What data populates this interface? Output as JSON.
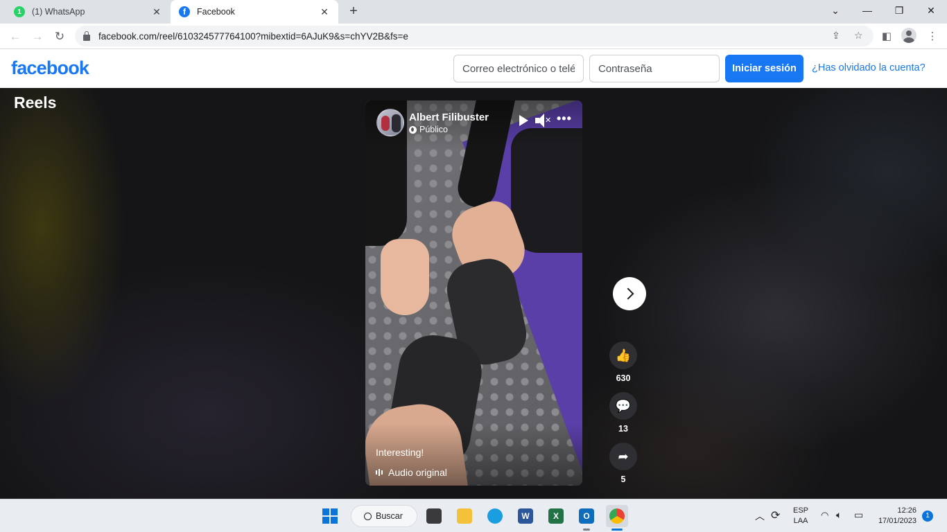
{
  "browser": {
    "tabs": [
      {
        "title": "(1) WhatsApp",
        "badge": "1"
      },
      {
        "title": "Facebook",
        "badge": "f"
      }
    ],
    "url": "facebook.com/reel/610324577764100?mibextid=6AJuK9&s=chYV2B&fs=e"
  },
  "fb": {
    "logo": "facebook",
    "email_placeholder": "Correo electrónico o teléfono",
    "password_placeholder": "Contraseña",
    "login_label": "Iniciar sesión",
    "forgot_label": "¿Has olvidado la cuenta?"
  },
  "reels": {
    "title": "Reels",
    "video": {
      "author": "Albert Filibuster",
      "privacy": "Público",
      "caption": "Interesting!",
      "audio": "Audio original"
    },
    "actions": {
      "likes": "630",
      "comments": "13",
      "shares": "5"
    }
  },
  "taskbar": {
    "search_label": "Buscar",
    "lang_line1": "ESP",
    "lang_line2": "LAA",
    "time": "12:26",
    "date": "17/01/2023",
    "notifications": "1"
  },
  "colors": {
    "fb_blue": "#1877f2",
    "stage_bg": "#151517",
    "mat_purple": "#5a3fa8"
  }
}
